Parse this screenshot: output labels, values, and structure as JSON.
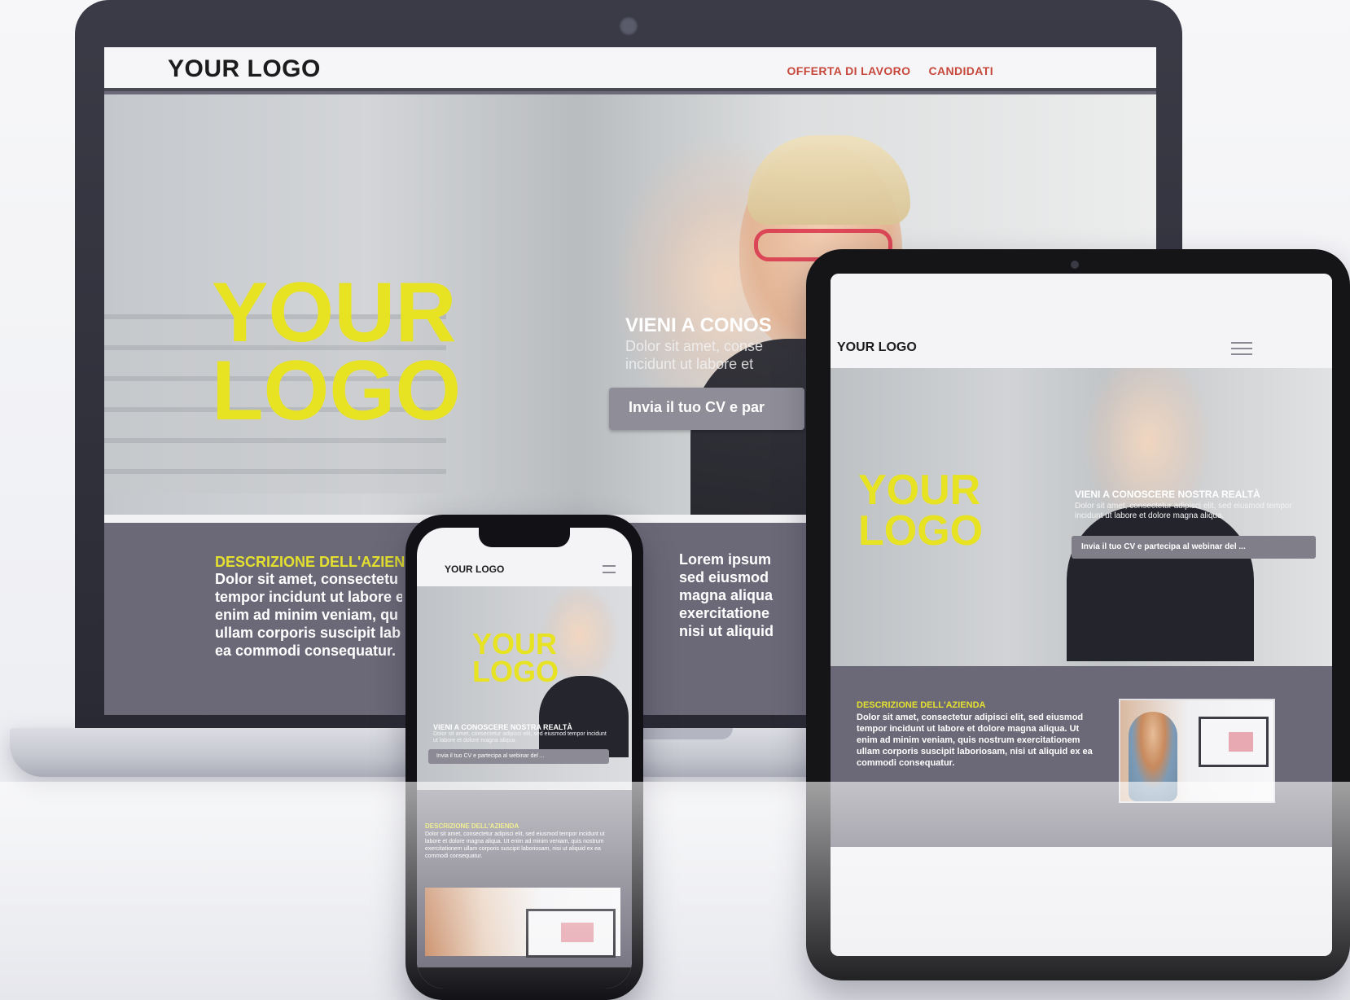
{
  "laptop": {
    "brand": "YOUR LOGO",
    "nav": [
      "OFFERTA DI LAVORO",
      "CANDIDATI"
    ],
    "hero": {
      "big_logo_line1": "YOUR",
      "big_logo_line2": "LOGO",
      "title": "VIENI A CONOS",
      "text_line1": "Dolor sit amet, conse",
      "text_line2": "incidunt ut labore et",
      "cta": "Invia il tuo CV e par"
    },
    "description": {
      "title": "DESCRIZIONE DELL'AZIEN",
      "lines": [
        "Dolor sit amet, consectetu",
        "tempor incidunt ut labore e",
        "enim ad minim veniam, qu",
        "ullam corporis suscipit lab",
        "ea commodi consequatur."
      ],
      "right_lines": [
        "Lorem ipsum",
        "sed eiusmod",
        "magna aliqua",
        "exercitatione",
        "nisi ut aliquid"
      ]
    }
  },
  "tablet": {
    "brand": "YOUR LOGO",
    "hero": {
      "big_logo_line1": "YOUR",
      "big_logo_line2": "LOGO",
      "title": "VIENI A CONOSCERE NOSTRA REALTÀ",
      "text": "Dolor sit amet, consectetur adipisci elit, sed eiusmod tempor incidunt ut labore et dolore magna aliqua.",
      "cta": "Invia il tuo CV e partecipa al webinar del ..."
    },
    "description": {
      "title": "DESCRIZIONE DELL'AZIENDA",
      "text": "Dolor sit amet, consectetur adipisci elit, sed eiusmod tempor incidunt ut labore et dolore magna aliqua. Ut enim ad minim veniam, quis nostrum exercitationem ullam corporis suscipit laboriosam, nisi ut aliquid ex ea commodi consequatur."
    }
  },
  "phone": {
    "brand": "YOUR LOGO",
    "hero": {
      "big_logo_line1": "YOUR",
      "big_logo_line2": "LOGO",
      "title": "VIENI A CONOSCERE NOSTRA REALTÀ",
      "text": "Dolor sit amet, consectetur adipisci elit, sed eiusmod tempor incidunt ut labore et dolore magna aliqua.",
      "cta": "Invia il tuo CV e partecipa al webinar del ..."
    },
    "description": {
      "title": "DESCRIZIONE DELL'AZIENDA",
      "text": "Dolor sit amet, consectetur adipisci elit, sed eiusmod tempor incidunt ut labore et dolore magna aliqua. Ut enim ad minim veniam, quis nostrum exercitationem ullam corporis suscipit laboriosam, nisi ut aliquid ex ea commodi consequatur."
    }
  },
  "colors": {
    "accent_yellow": "#e7e323",
    "nav_red": "#c7473a",
    "description_bg": "#6b6977",
    "device_frame": "#151518"
  }
}
